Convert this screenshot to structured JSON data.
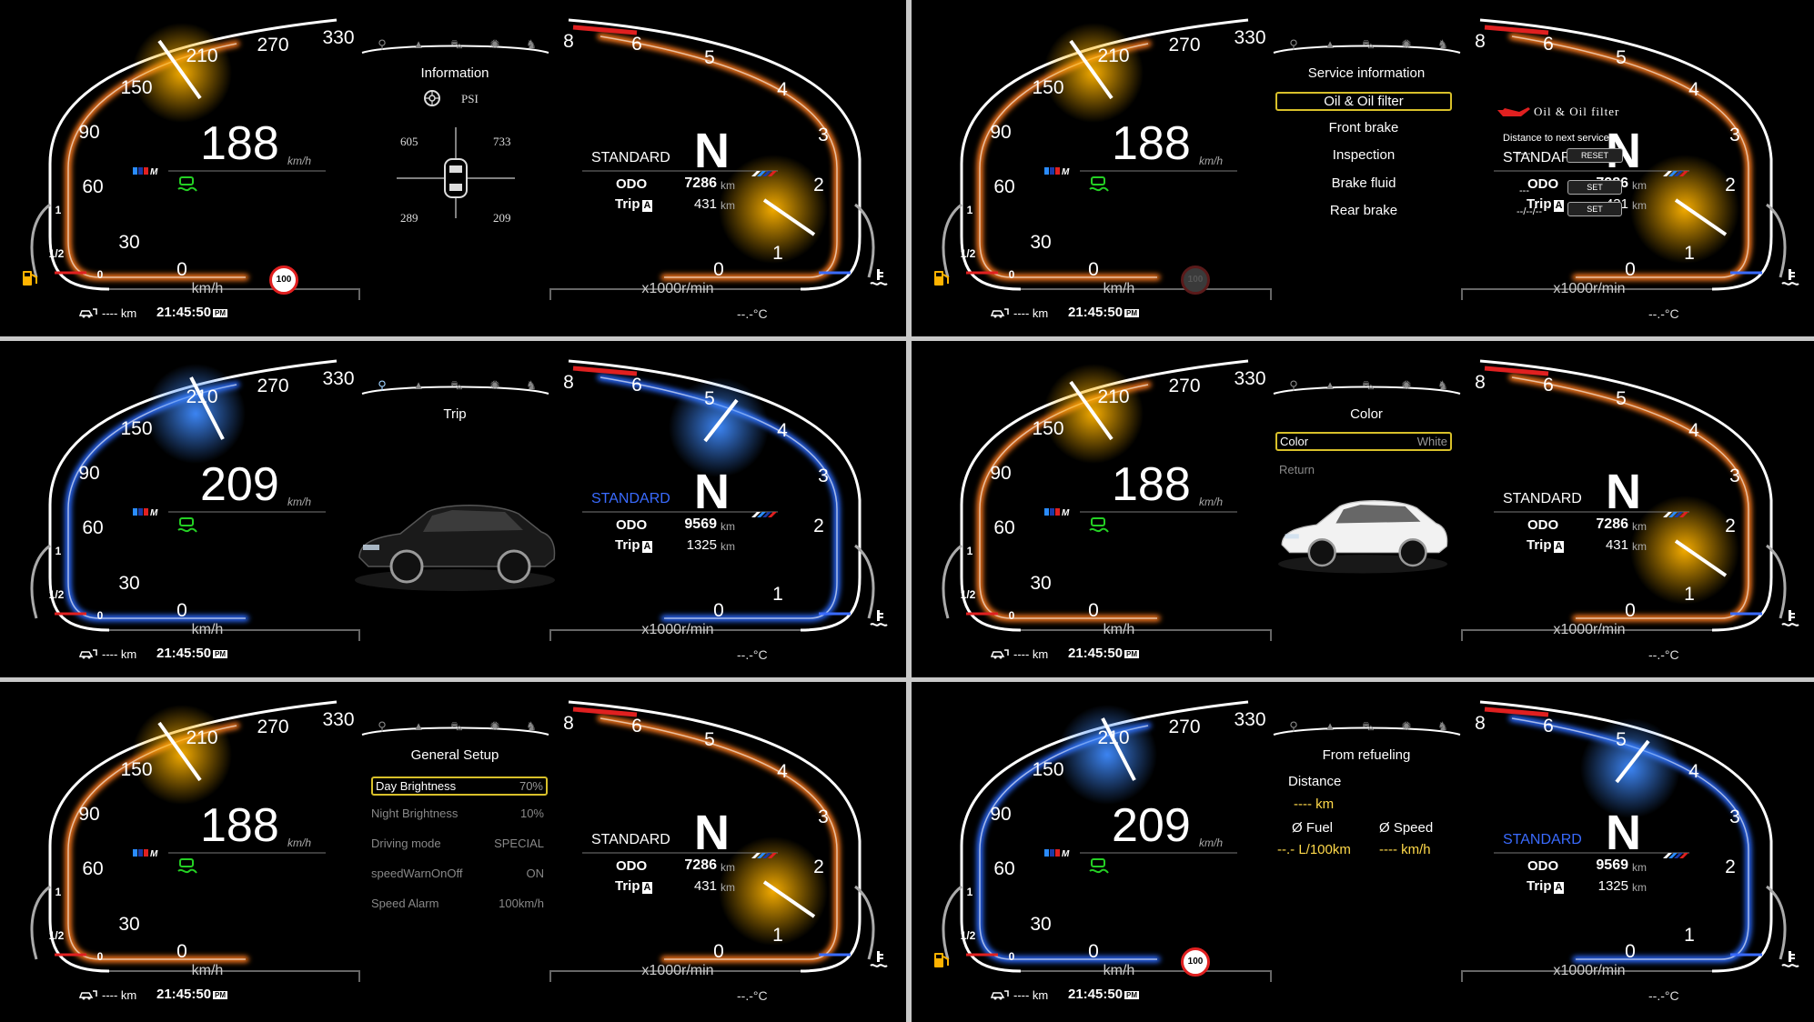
{
  "common": {
    "kmh": "km/h",
    "rpm_unit": "x1000r/min",
    "odo_label": "ODO",
    "trip_label": "Trip",
    "trip_letter": "A",
    "km": "km",
    "range": "---- km",
    "clock": "21:45:50",
    "pm": "PM",
    "temp": "--.-°C",
    "gear": "N",
    "speed_ticks": [
      "0",
      "30",
      "60",
      "90",
      "150",
      "210",
      "270",
      "330"
    ],
    "rpm_ticks": [
      "0",
      "1",
      "2",
      "3",
      "4",
      "5",
      "6",
      "8"
    ],
    "fuel_ticks": [
      "0",
      "1/2",
      "1"
    ],
    "speed_limit": "100",
    "tabs": [
      "navigation-icon",
      "warning-icon",
      "car-icon",
      "gear-icon",
      "shirt-icon"
    ]
  },
  "panels": [
    {
      "id": "p1",
      "theme": "orange",
      "speed": "188",
      "mode": "STANDARD",
      "odo": "7286",
      "trip": "431",
      "needle_speed": 188,
      "needle_rpm": 1.5,
      "center": {
        "title": "Information",
        "psi": "PSI",
        "fl": "605",
        "fr": "733",
        "rl": "289",
        "rr": "209"
      }
    },
    {
      "id": "p2",
      "theme": "orange",
      "speed": "188",
      "mode": "STANDARD",
      "odo": "7286",
      "trip": "431",
      "center": {
        "title": "Service information",
        "items": [
          "Oil & Oil filter",
          "Front brake",
          "Inspection",
          "Brake fluid",
          "Rear brake"
        ],
        "oil_label": "Oil & Oil filter",
        "distance_label": "Distance to next service",
        "dist_value": "----",
        "date_value": "---",
        "date_value2": "--/--/--",
        "reset": "RESET",
        "set1": "SET",
        "set2": "SET"
      }
    },
    {
      "id": "p3",
      "theme": "blue",
      "speed": "209",
      "mode": "STANDARD",
      "odo": "9569",
      "trip": "1325",
      "center": {
        "title": "Trip"
      }
    },
    {
      "id": "p4",
      "theme": "orange",
      "speed": "188",
      "mode": "STANDARD",
      "odo": "7286",
      "trip": "431",
      "center": {
        "title": "Color",
        "color_label": "Color",
        "color_value": "White",
        "return": "Return"
      }
    },
    {
      "id": "p5",
      "theme": "orange",
      "speed": "188",
      "mode": "STANDARD",
      "odo": "7286",
      "trip": "431",
      "center": {
        "title": "General Setup",
        "rows": [
          {
            "label": "Day Brightness",
            "value": "70%"
          },
          {
            "label": "Night Brightness",
            "value": "10%"
          },
          {
            "label": "Driving mode",
            "value": "SPECIAL"
          },
          {
            "label": "speedWarnOnOff",
            "value": "ON"
          },
          {
            "label": "Speed Alarm",
            "value": "100km/h"
          }
        ]
      }
    },
    {
      "id": "p6",
      "theme": "blue",
      "speed": "209",
      "mode": "STANDARD",
      "odo": "9569",
      "trip": "1325",
      "center": {
        "title": "From refueling",
        "distance": "Distance",
        "distance_value": "---- km",
        "fuel": "Ø Fuel",
        "speed": "Ø Speed",
        "fuel_value": "--.- L/100km",
        "speed_value": "---- km/h"
      }
    }
  ],
  "colors": {
    "orange": "#ff7a1a",
    "orange_glow": "#ffb300",
    "blue": "#2a6bff",
    "blue_glow": "#3f8bff",
    "highlight": "#d8c02a",
    "green": "#24d024",
    "red": "#e02020"
  }
}
